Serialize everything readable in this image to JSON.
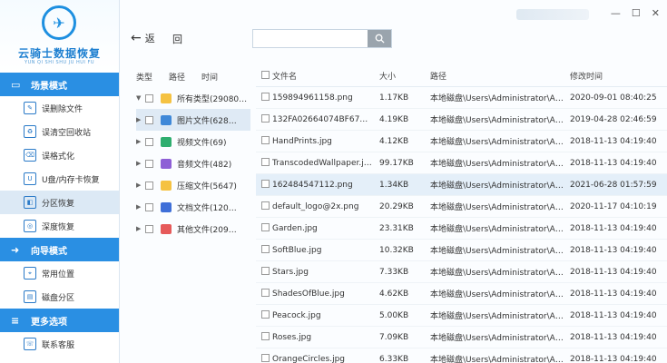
{
  "app": {
    "title": "云骑士数据恢复",
    "subtitle": "YUN QI SHI SHU JU HUI FU",
    "logo_glyph": "✈"
  },
  "sidebar": {
    "sections": [
      {
        "title": "场景模式",
        "icon": "monitor-icon",
        "items": [
          {
            "label": "误删除文件",
            "icon": "delete-file-icon"
          },
          {
            "label": "误清空回收站",
            "icon": "recycle-bin-icon"
          },
          {
            "label": "误格式化",
            "icon": "format-icon"
          },
          {
            "label": "U盘/内存卡恢复",
            "icon": "usb-icon"
          },
          {
            "label": "分区恢复",
            "icon": "partition-icon",
            "active": true
          },
          {
            "label": "深度恢复",
            "icon": "deep-scan-icon"
          }
        ]
      },
      {
        "title": "向导模式",
        "icon": "wizard-icon",
        "items": [
          {
            "label": "常用位置",
            "icon": "location-icon"
          },
          {
            "label": "磁盘分区",
            "icon": "disk-icon"
          }
        ]
      },
      {
        "title": "更多选项",
        "icon": "menu-icon",
        "items": [
          {
            "label": "联系客服",
            "icon": "headset-icon"
          }
        ]
      }
    ]
  },
  "toolbar": {
    "back_label": "返",
    "return_label": "回",
    "search_placeholder": ""
  },
  "tree": {
    "headers": [
      "类型",
      "路径",
      "时间"
    ],
    "rows": [
      {
        "label": "所有类型(29080…",
        "expand": "▼",
        "color": "#f5c242",
        "selected": false
      },
      {
        "label": "图片文件(628…",
        "expand": "▶",
        "color": "#3f88d8",
        "selected": true
      },
      {
        "label": "视频文件(69)",
        "expand": "▶",
        "color": "#2fae6f",
        "selected": false
      },
      {
        "label": "音频文件(482)",
        "expand": "▶",
        "color": "#8e5fd6",
        "selected": false
      },
      {
        "label": "压缩文件(5647)",
        "expand": "▶",
        "color": "#f5c242",
        "selected": false
      },
      {
        "label": "文档文件(120…",
        "expand": "▶",
        "color": "#3f6fd8",
        "selected": false
      },
      {
        "label": "其他文件(209…",
        "expand": "▶",
        "color": "#e65a5a",
        "selected": false
      }
    ]
  },
  "table": {
    "headers": {
      "name": "文件名",
      "size": "大小",
      "path": "路径",
      "time": "修改时间"
    },
    "rows": [
      {
        "name": "159894961158.png",
        "size": "1.17KB",
        "path": "本地磁盘\\Users\\Administrator\\Ap…",
        "time": "2020-09-01 08:40:25",
        "hl": false
      },
      {
        "name": "132FA02664074BF67…",
        "size": "4.19KB",
        "path": "本地磁盘\\Users\\Administrator\\Ap…",
        "time": "2019-04-28 02:46:59",
        "hl": false
      },
      {
        "name": "HandPrints.jpg",
        "size": "4.12KB",
        "path": "本地磁盘\\Users\\Administrator\\Ap…",
        "time": "2018-11-13 04:19:40",
        "hl": false
      },
      {
        "name": "TranscodedWallpaper.j…",
        "size": "99.17KB",
        "path": "本地磁盘\\Users\\Administrator\\Ap…",
        "time": "2018-11-13 04:19:40",
        "hl": false
      },
      {
        "name": "162484547112.png",
        "size": "1.34KB",
        "path": "本地磁盘\\Users\\Administrator\\Ap…",
        "time": "2021-06-28 01:57:59",
        "hl": true
      },
      {
        "name": "default_logo@2x.png",
        "size": "20.29KB",
        "path": "本地磁盘\\Users\\Administrator\\Ap…",
        "time": "2020-11-17 04:10:19",
        "hl": false
      },
      {
        "name": "Garden.jpg",
        "size": "23.31KB",
        "path": "本地磁盘\\Users\\Administrator\\Ap…",
        "time": "2018-11-13 04:19:40",
        "hl": false
      },
      {
        "name": "SoftBlue.jpg",
        "size": "10.32KB",
        "path": "本地磁盘\\Users\\Administrator\\Ap…",
        "time": "2018-11-13 04:19:40",
        "hl": false
      },
      {
        "name": "Stars.jpg",
        "size": "7.33KB",
        "path": "本地磁盘\\Users\\Administrator\\Ap…",
        "time": "2018-11-13 04:19:40",
        "hl": false
      },
      {
        "name": "ShadesOfBlue.jpg",
        "size": "4.62KB",
        "path": "本地磁盘\\Users\\Administrator\\Ap…",
        "time": "2018-11-13 04:19:40",
        "hl": false
      },
      {
        "name": "Peacock.jpg",
        "size": "5.00KB",
        "path": "本地磁盘\\Users\\Administrator\\Ap…",
        "time": "2018-11-13 04:19:40",
        "hl": false
      },
      {
        "name": "Roses.jpg",
        "size": "7.09KB",
        "path": "本地磁盘\\Users\\Administrator\\Ap…",
        "time": "2018-11-13 04:19:40",
        "hl": false
      },
      {
        "name": "OrangeCircles.jpg",
        "size": "6.33KB",
        "path": "本地磁盘\\Users\\Administrator\\Ap…",
        "time": "2018-11-13 04:19:40",
        "hl": false
      }
    ]
  },
  "window": {
    "minimize": "—",
    "maximize": "☐",
    "close": "✕"
  }
}
